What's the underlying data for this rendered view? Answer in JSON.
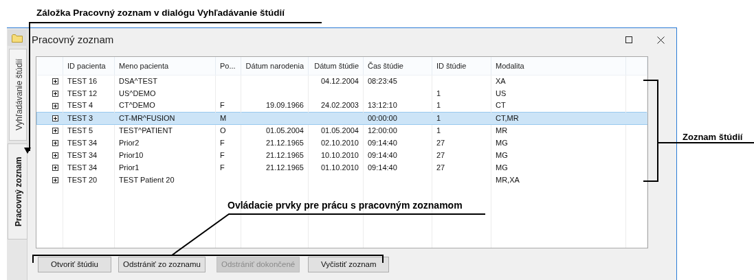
{
  "annotations": [
    {
      "text": "Záložka Pracovný zoznam v dialógu Vyhľadávanie štúdií"
    },
    {
      "text": "Zoznam štúdií"
    },
    {
      "text": "Ovládacie prvky pre prácu s pracovným zoznamom"
    }
  ],
  "window": {
    "title": "Pracovný zoznam"
  },
  "side_tabs": [
    {
      "label": "Vyhľadávanie štúdií",
      "selected": false
    },
    {
      "label": "Pracovný zoznam",
      "selected": true
    }
  ],
  "table": {
    "columns": [
      "ID pacienta",
      "Meno pacienta",
      "Po...",
      "Dátum narodenia",
      "Dátum štúdie",
      "Čas štúdie",
      "ID štúdie",
      "Modalita"
    ],
    "rows": [
      {
        "expanded": false,
        "selected": false,
        "cells": [
          "TEST 16",
          "DSA^TEST",
          "",
          "",
          "04.12.2004",
          "08:23:45",
          "",
          "XA"
        ]
      },
      {
        "expanded": false,
        "selected": false,
        "cells": [
          "TEST 12",
          "US^DEMO",
          "",
          "",
          "",
          "",
          "1",
          "US"
        ]
      },
      {
        "expanded": false,
        "selected": false,
        "cells": [
          "TEST 4",
          "CT^DEMO",
          "F",
          "19.09.1966",
          "24.02.2003",
          "13:12:10",
          "1",
          "CT"
        ]
      },
      {
        "expanded": false,
        "selected": true,
        "cells": [
          "TEST 3",
          "CT-MR^FUSION",
          "M",
          "",
          "",
          "00:00:00",
          "1",
          "CT,MR"
        ]
      },
      {
        "expanded": false,
        "selected": false,
        "cells": [
          "TEST 5",
          "TEST^PATIENT",
          "O",
          "01.05.2004",
          "01.05.2004",
          "12:00:00",
          "1",
          "MR"
        ]
      },
      {
        "expanded": false,
        "selected": false,
        "cells": [
          "TEST 34",
          "Prior2",
          "F",
          "21.12.1965",
          "02.10.2010",
          "09:14:40",
          "27",
          "MG"
        ]
      },
      {
        "expanded": false,
        "selected": false,
        "cells": [
          "TEST 34",
          "Prior10",
          "F",
          "21.12.1965",
          "10.10.2010",
          "09:14:40",
          "27",
          "MG"
        ]
      },
      {
        "expanded": false,
        "selected": false,
        "cells": [
          "TEST 34",
          "Prior1",
          "F",
          "21.12.1965",
          "01.10.2010",
          "09:14:40",
          "27",
          "MG"
        ]
      },
      {
        "expanded": false,
        "selected": false,
        "cells": [
          "TEST 20",
          "TEST Patient 20",
          "",
          "",
          "",
          "",
          "",
          "MR,XA"
        ]
      }
    ]
  },
  "buttons": [
    {
      "label": "Otvoriť štúdiu",
      "disabled": false
    },
    {
      "label": "Odstrániť zo zoznamu",
      "disabled": false
    },
    {
      "label": "Odstrániť dokončené",
      "disabled": true
    },
    {
      "label": "Vyčistiť zoznam",
      "disabled": false
    }
  ]
}
